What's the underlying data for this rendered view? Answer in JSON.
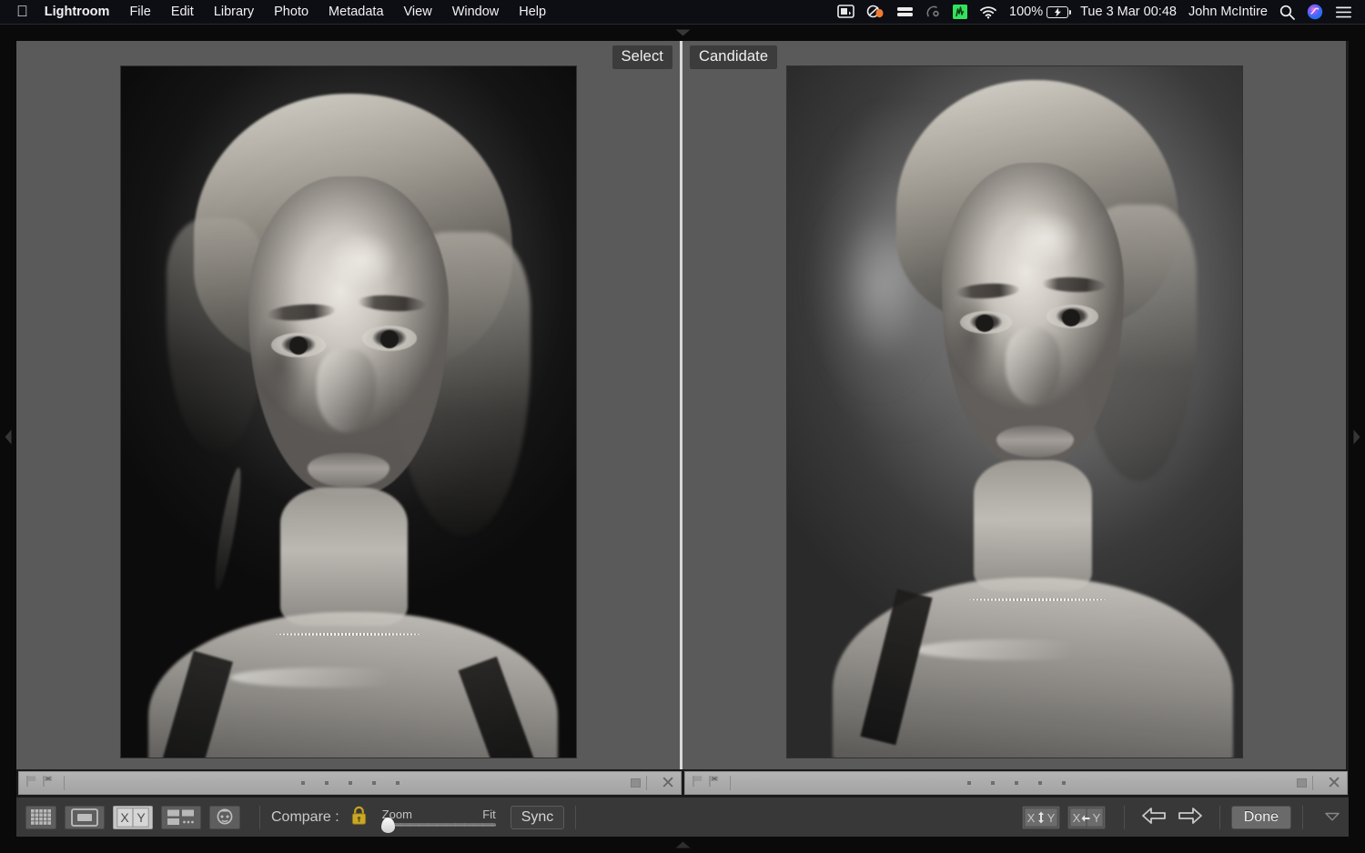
{
  "menubar": {
    "apple_icon": "apple-logo",
    "app_name": "Lightroom",
    "items": [
      "File",
      "Edit",
      "Library",
      "Photo",
      "Metadata",
      "View",
      "Window",
      "Help"
    ],
    "status_icons": [
      "screen-sharing-icon",
      "shortcuts-icon",
      "backup-icon",
      "airdrop-icon",
      "activity-monitor-icon",
      "wifi-icon"
    ],
    "battery_percent": "100%",
    "battery_icon": "battery-charging-icon",
    "datetime": "Tue 3 Mar  00:48",
    "user": "John McIntire",
    "search_icon": "search-icon",
    "siri_icon": "siri-icon",
    "control_center_icon": "control-center-icon"
  },
  "panes": {
    "select": {
      "label": "Select"
    },
    "candidate": {
      "label": "Candidate"
    }
  },
  "infobar": {
    "flag_pick_icon": "flag-pick-icon",
    "flag_reject_icon": "flag-reject-icon",
    "star_count": 5,
    "crop_icon": "crop-overlay-icon",
    "close_icon": "close-icon"
  },
  "toolbar": {
    "view_modes": [
      {
        "name": "grid-view",
        "icon": "grid-icon",
        "active": false
      },
      {
        "name": "loupe-view",
        "icon": "loupe-icon",
        "active": false
      },
      {
        "name": "compare-view",
        "icon": "compare-xy-icon",
        "active": true
      },
      {
        "name": "survey-view",
        "icon": "survey-icon",
        "active": false
      },
      {
        "name": "people-view",
        "icon": "people-icon",
        "active": false
      }
    ],
    "compare_label": "Compare :",
    "lock_icon": "lock-closed-icon",
    "zoom_label": "Zoom",
    "zoom_fit_label": "Fit",
    "zoom_value": 0,
    "sync_label": "Sync",
    "swap_buttons": [
      {
        "name": "swap-xy-button",
        "label_x": "X",
        "label_y": "Y",
        "icon": "swap-vertical-icon"
      },
      {
        "name": "make-select-button",
        "label_x": "X",
        "label_y": "Y",
        "icon": "arrow-left-icon"
      }
    ],
    "prev_icon": "arrow-left-icon",
    "next_icon": "arrow-right-icon",
    "done_label": "Done",
    "toolbar_toggle_icon": "chevron-down-icon"
  },
  "edges": {
    "top_icon": "panel-toggle-down-icon",
    "bottom_icon": "panel-toggle-up-icon",
    "left_icon": "panel-toggle-left-icon",
    "right_icon": "panel-toggle-right-icon"
  },
  "colors": {
    "menubar_bg": "#0d0d14",
    "pane_bg": "#5a5a5a",
    "toolbar_bg": "#383838",
    "infobar_bg": "#ababab",
    "label_bg": "#3c3c3c",
    "accent_green": "#35e05c"
  }
}
